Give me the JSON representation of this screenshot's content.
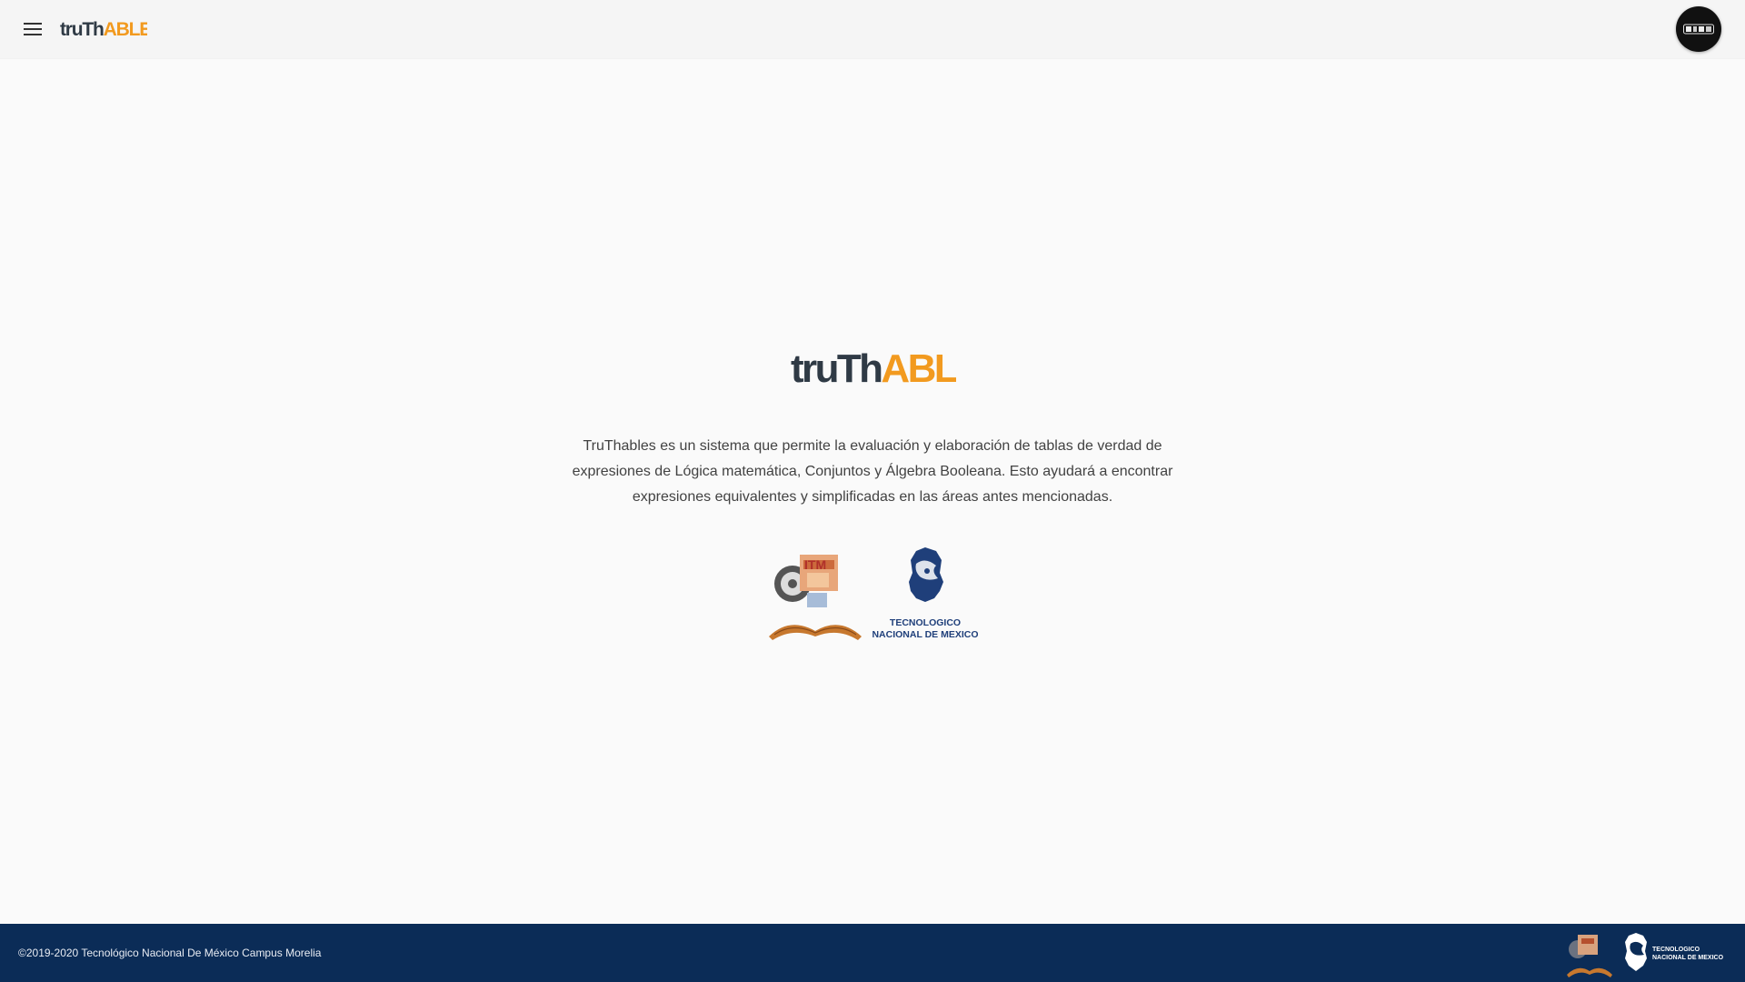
{
  "header": {
    "menu_icon": "menu-icon",
    "logo": {
      "part1": "truTh",
      "part2": "ABLES"
    },
    "avatar_icon": "user-avatar"
  },
  "main": {
    "logo": {
      "part1": "truTh",
      "part2": "ABLES"
    },
    "description": "TruThables es un sistema que permite la evaluación y elaboración de tablas de verdad de expresiones de Lógica matemática, Conjuntos y Álgebra Booleana. Esto ayudará a encontrar expresiones equivalentes y simplificadas en las áreas antes mencionadas.",
    "institution_logos": {
      "itm": {
        "text": "ITM"
      },
      "tecnm": {
        "line1": "TECNOLOGICO",
        "line2": "NACIONAL DE MEXICO"
      }
    }
  },
  "footer": {
    "copyright": "©2019-2020 Tecnológico Nacional De México Campus Morelia",
    "tecnm": {
      "line1": "TECNOLOGICO",
      "line2": "NACIONAL DE MEXICO"
    }
  },
  "colors": {
    "brand_dark": "#2f3a45",
    "brand_orange": "#f29a1f",
    "footer_bg": "#0b2c57",
    "tecnm_blue": "#1f3f7a"
  }
}
